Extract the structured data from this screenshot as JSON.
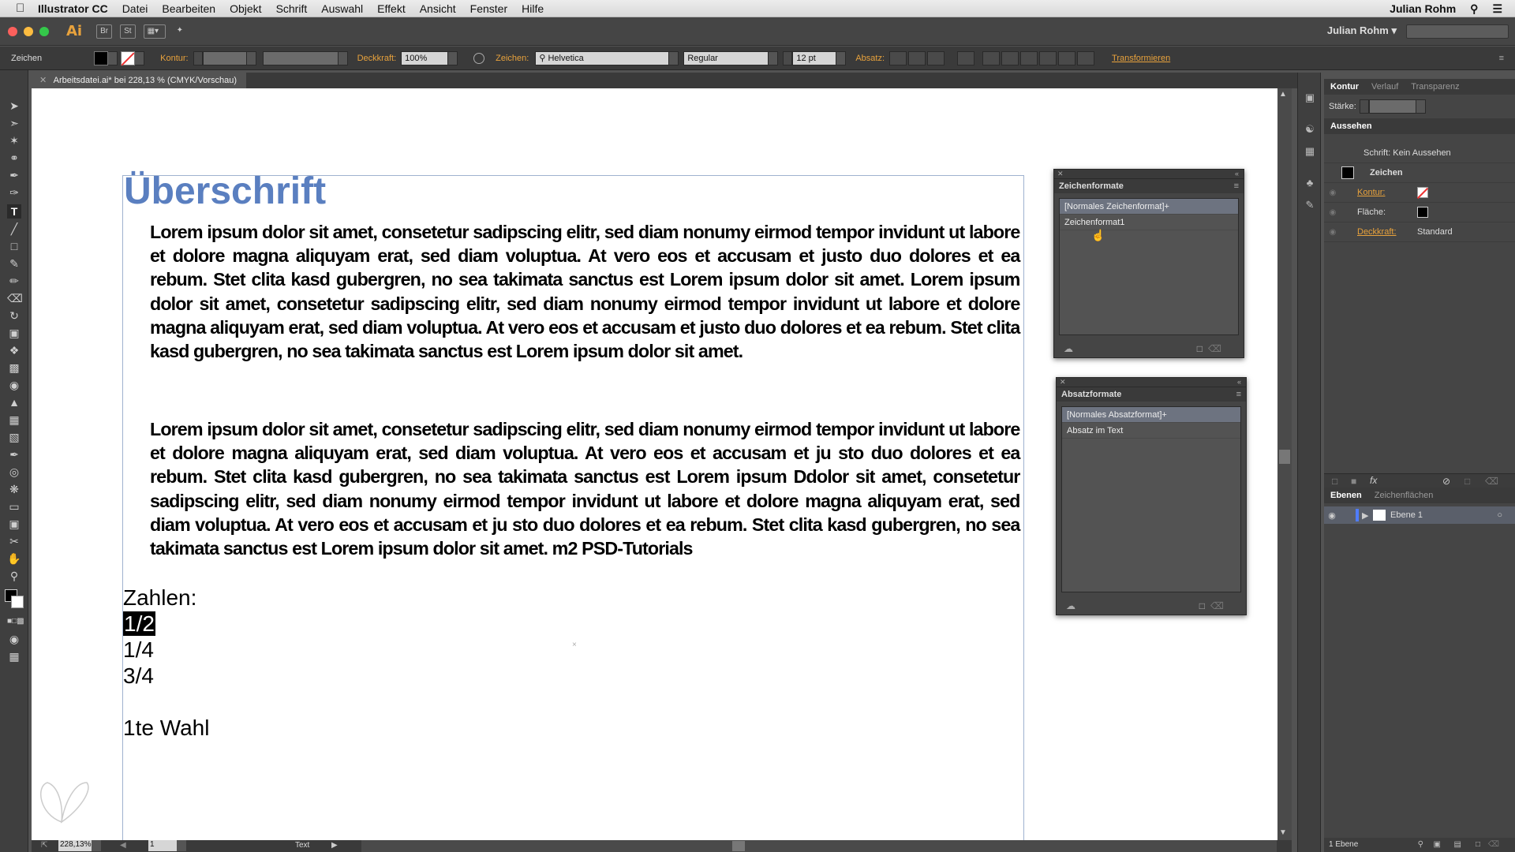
{
  "menubar": {
    "app": "Illustrator CC",
    "items": [
      "Datei",
      "Bearbeiten",
      "Objekt",
      "Schrift",
      "Auswahl",
      "Effekt",
      "Ansicht",
      "Fenster",
      "Hilfe"
    ],
    "user": "Julian Rohm"
  },
  "appbar": {
    "logo": "Ai",
    "bridge": "Br",
    "stock": "St",
    "user": "Julian Rohm"
  },
  "control": {
    "mode": "Zeichen",
    "kontur_label": "Kontur:",
    "deckkraft_label": "Deckkraft:",
    "deckkraft_value": "100%",
    "zeichen_label": "Zeichen:",
    "font": "Helvetica",
    "style": "Regular",
    "size": "12 pt",
    "absatz_label": "Absatz:",
    "transformieren": "Transformieren"
  },
  "document": {
    "tab": "Arbeitsdatei.ai* bei 228,13 % (CMYK/Vorschau)",
    "heading": "Überschrift",
    "para1": "Lorem ipsum dolor sit amet, consetetur sadipscing elitr, sed diam nonumy eirmod tempor invidunt ut labore et dolore magna aliquyam erat, sed diam voluptua. At vero eos et accusam et justo duo dolores et ea rebum. Stet clita kasd gubergren, no sea takimata sanctus est Lorem ipsum dolor sit amet. Lorem ipsum dolor sit amet, consetetur sadipscing elitr, sed diam nonumy eirmod tempor invidunt ut labore et dolore magna aliquyam erat, sed diam voluptua. At vero eos et accusam et justo duo dolores et ea rebum. Stet clita kasd gubergren, no sea takimata sanctus est Lorem ipsum dolor sit amet.",
    "para2": "Lorem ipsum dolor sit amet, consetetur sadipscing elitr, sed diam nonumy eirmod tempor invidunt ut labore et dolore magna aliquyam erat, sed diam voluptua. At vero eos et accusam et ju sto duo dolores et ea rebum. Stet clita kasd gubergren, no sea takimata sanctus est Lorem ipsum Ddolor sit amet, consetetur sadipscing elitr, sed diam nonumy eirmod tempor invidunt ut labore et dolore magna aliquyam erat, sed diam voluptua. At vero eos et accusam et ju sto duo dolores et ea rebum. Stet clita kasd gubergren, no sea takimata sanctus est Lorem ipsum dolor sit amet. m2 PSD-Tutorials",
    "zahlen": "Zahlen:",
    "n1": "1/2",
    "n2": "1/4",
    "n3": "3/4",
    "wahl": "1te Wahl"
  },
  "status": {
    "zoom": "228,13%",
    "page": "1",
    "tool": "Text"
  },
  "zeichenformate": {
    "title": "Zeichenformate",
    "items": [
      "[Normales Zeichenformat]+",
      "Zeichenformat1"
    ]
  },
  "absatzformate": {
    "title": "Absatzformate",
    "items": [
      "[Normales Absatzformat]+",
      "Absatz im Text"
    ]
  },
  "kontur": {
    "tabs": [
      "Kontur",
      "Verlauf",
      "Transparenz"
    ],
    "staerke_label": "Stärke:"
  },
  "aussehen": {
    "title": "Aussehen",
    "header": "Schrift: Kein Aussehen",
    "zeichen": "Zeichen",
    "kontur": "Kontur:",
    "flaeche": "Fläche:",
    "deckkraft": "Deckkraft:",
    "deckkraft_value": "Standard"
  },
  "ebenen": {
    "tabs": [
      "Ebenen",
      "Zeichenflächen"
    ],
    "layer": "Ebene 1",
    "count": "1 Ebene"
  }
}
